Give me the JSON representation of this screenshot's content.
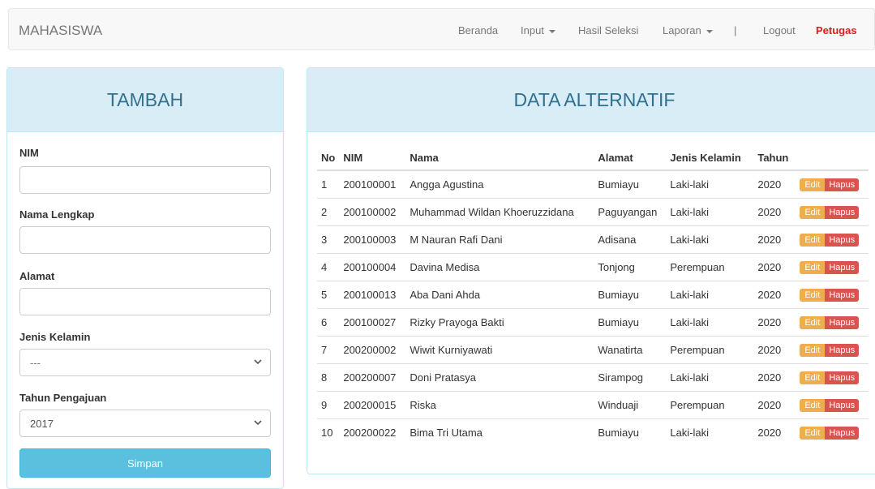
{
  "navbar": {
    "brand": "MAHASISWA",
    "beranda": "Beranda",
    "input": "Input",
    "hasil_seleksi": "Hasil Seleksi",
    "laporan": "Laporan",
    "separator": "|",
    "logout": "Logout",
    "user": "Petugas"
  },
  "form": {
    "title": "TAMBAH",
    "nim_label": "NIM",
    "nim_value": "",
    "nama_label": "Nama Lengkap",
    "nama_value": "",
    "alamat_label": "Alamat",
    "alamat_value": "",
    "jk_label": "Jenis Kelamin",
    "jk_value": "---",
    "tahun_label": "Tahun Pengajuan",
    "tahun_value": "2017",
    "submit": "Simpan"
  },
  "table": {
    "title": "DATA ALTERNATIF",
    "headers": [
      "No",
      "NIM",
      "Nama",
      "Alamat",
      "Jenis Kelamin",
      "Tahun",
      ""
    ],
    "edit_label": "Edit",
    "hapus_label": "Hapus",
    "rows": [
      [
        "1",
        "200100001",
        "Angga Agustina",
        "Bumiayu",
        "Laki-laki",
        "2020"
      ],
      [
        "2",
        "200100002",
        "Muhammad Wildan Khoeruzzidana",
        "Paguyangan",
        "Laki-laki",
        "2020"
      ],
      [
        "3",
        "200100003",
        "M Nauran Rafi Dani",
        "Adisana",
        "Laki-laki",
        "2020"
      ],
      [
        "4",
        "200100004",
        "Davina Medisa",
        "Tonjong",
        "Perempuan",
        "2020"
      ],
      [
        "5",
        "200100013",
        "Aba Dani Ahda",
        "Bumiayu",
        "Laki-laki",
        "2020"
      ],
      [
        "6",
        "200100027",
        "Rizky Prayoga Bakti",
        "Bumiayu",
        "Laki-laki",
        "2020"
      ],
      [
        "7",
        "200200002",
        "Wiwit Kurniyawati",
        "Wanatirta",
        "Perempuan",
        "2020"
      ],
      [
        "8",
        "200200007",
        "Doni Pratasya",
        "Sirampog",
        "Laki-laki",
        "2020"
      ],
      [
        "9",
        "200200015",
        "Riska",
        "Winduaji",
        "Perempuan",
        "2020"
      ],
      [
        "10",
        "200200022",
        "Bima Tri Utama",
        "Bumiayu",
        "Laki-laki",
        "2020"
      ]
    ]
  }
}
